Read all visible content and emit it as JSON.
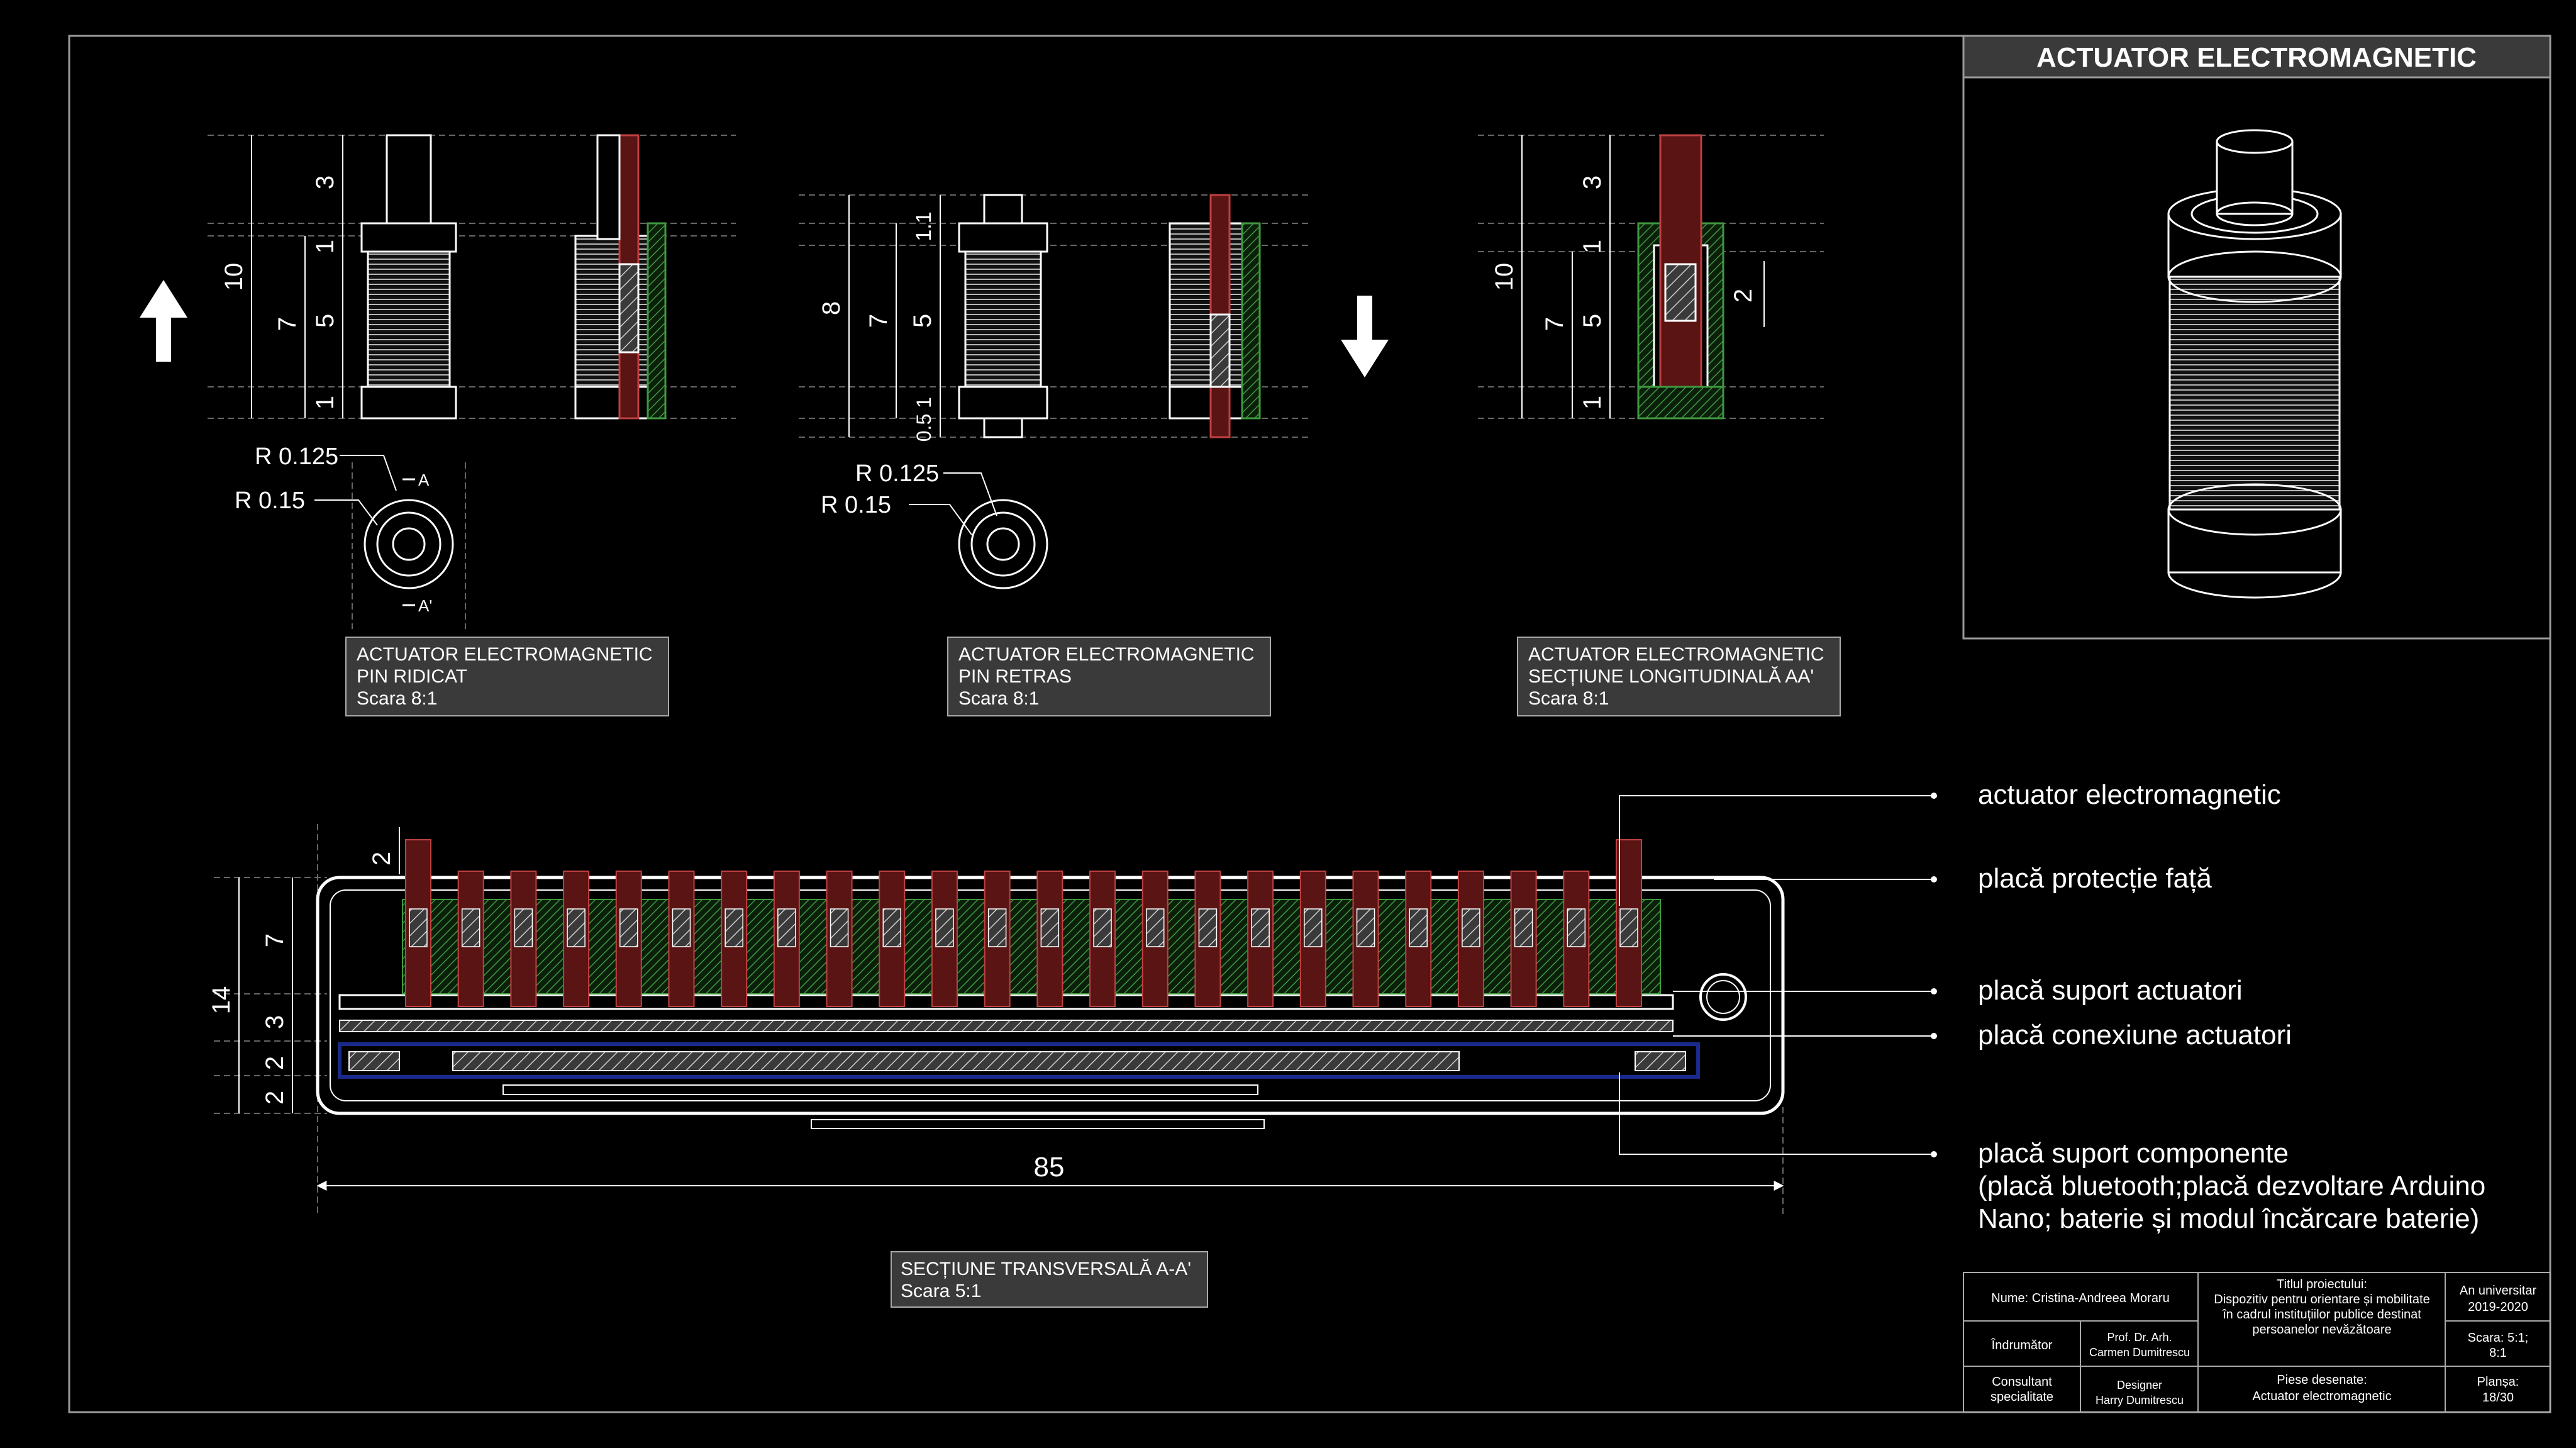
{
  "top_right_panel": {
    "title": "ACTUATOR ELECTROMAGNETIC"
  },
  "view_up": {
    "caption": [
      "ACTUATOR ELECTROMAGNETIC",
      "PIN RIDICAT",
      "Scara 8:1"
    ],
    "dims_outer": "10",
    "dims_mid": "7",
    "dims_inner": [
      "3",
      "1",
      "5",
      "1"
    ],
    "radii": [
      "R 0.125",
      "R 0.15"
    ],
    "section_marks": [
      "A",
      "A'"
    ],
    "arrow": "up"
  },
  "view_down": {
    "caption": [
      "ACTUATOR ELECTROMAGNETIC",
      "PIN RETRAS",
      "Scara 8:1"
    ],
    "dims_outer": "8",
    "dims_mid": "7",
    "dims_inner": [
      "1.1",
      "5",
      "0.5",
      "1"
    ],
    "radii": [
      "R 0.125",
      "R 0.15"
    ],
    "arrow": "down"
  },
  "view_section": {
    "caption": [
      "ACTUATOR ELECTROMAGNETIC",
      "SECȚIUNE LONGITUDINALĂ AA'",
      "Scara 8:1"
    ],
    "dims_outer": "10",
    "dims_mid": "7",
    "dims_inner": [
      "3",
      "1",
      "5",
      "1"
    ],
    "dim_side": "2"
  },
  "cross_section": {
    "caption": [
      "SECȚIUNE TRANSVERSALĂ A-A'",
      "Scara 5:1"
    ],
    "dim_total_height": "14",
    "dims_left": [
      "7",
      "3",
      "2",
      "2"
    ],
    "dim_top": "2",
    "dim_length": "85",
    "actuator_count": 24
  },
  "legend": [
    "actuator electromagnetic",
    "placă protecție față",
    "placă suport actuatori",
    "placă conexiune actuatori",
    "placă  suport componente",
    "(placă bluetooth;placă dezvoltare Arduino",
    "Nano; baterie și modul încărcare baterie)"
  ],
  "title_block": {
    "name": "Nume: Cristina-Andreea Moraru",
    "project_label": "Titlul proiectului:",
    "project_title": [
      "Dispozitiv pentru orientare și mobilitate",
      "în cadrul instituțiilor publice destinat",
      "persoanelor nevăzătoare"
    ],
    "year_label": "An universitar",
    "year": "2019-2020",
    "guide_label": "Îndrumător",
    "guide": [
      "Prof. Dr. Arh.",
      "Carmen Dumitrescu"
    ],
    "scale": [
      "Scara: 5:1;",
      "8:1"
    ],
    "consultant_label": [
      "Consultant",
      "specialitate"
    ],
    "consultant": [
      "Designer",
      "Harry Dumitrescu"
    ],
    "drawings_label": "Piese desenate:",
    "drawings": "Actuator electromagnetic",
    "sheet_label": "Planșa:",
    "sheet": "18/30"
  },
  "colors": {
    "background": "#000000",
    "line": "#ffffff",
    "pin": "#5a1414",
    "spring": "#2e6b2e",
    "panel": "#3a3a3a",
    "pcb": "#1a2a8a"
  }
}
